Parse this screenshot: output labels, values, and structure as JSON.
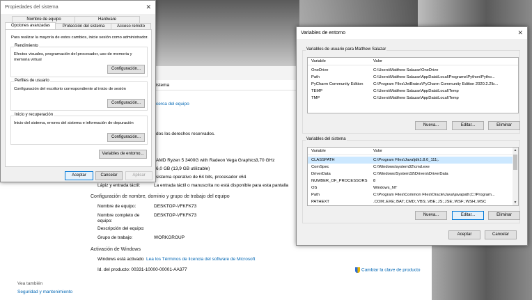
{
  "about": {
    "system_label_partial": "istema",
    "title_partial": "cerca del equipo",
    "rights_partial": "dos los derechos reservados.",
    "processor_value": "AMD Ryzen 5 3400G with Radeon Vega Graphics",
    "processor_speed": "3,70 GHz",
    "ram_value": "6,0 GB (13,9 GB utilizable)",
    "system_type_value": "sistema operativo de 64 bits, procesador x64",
    "pen_label": "Lápiz y entrada táctil:",
    "pen_value": "La entrada táctil o manuscrita no está disponible para esta pantalla",
    "domain_header": "Configuración de nombre, dominio y grupo de trabajo del equipo",
    "computer_name_label": "Nombre de equipo:",
    "computer_name_value": "DESKTOP-VFKFK73",
    "full_name_label": "Nombre completo de equipo:",
    "full_name_value": "DESKTOP-VFKFK73",
    "description_label": "Descripción del equipo:",
    "workgroup_label": "Grupo de trabajo:",
    "workgroup_value": "WORKGROUP",
    "activation_header": "Activación de Windows",
    "activation_status": "Windows está activado",
    "license_link": "Lea los Términos de licencia del software de Microsoft",
    "product_id": "Id. del producto: 00331-10000-00001-AA377",
    "change_key_link": "Cambiar la clave de producto",
    "see_also": "Vea también",
    "security_link": "Seguridad y mantenimiento"
  },
  "sysprop": {
    "title": "Propiedades del sistema",
    "tabs_top": [
      "Nombre de equipo",
      "Hardware"
    ],
    "tabs_bottom": [
      "Opciones avanzadas",
      "Protección del sistema",
      "Acceso remoto"
    ],
    "admin_note": "Para realizar la mayoría de estos cambios, inicie sesión como administrador.",
    "perf_label": "Rendimiento",
    "perf_text": "Efectos visuales, programación del procesador, uso de memoria y memoria virtual",
    "profiles_label": "Perfiles de usuario",
    "profiles_text": "Configuración del escritorio correspondiente al inicio de sesión",
    "startup_label": "Inicio y recuperación",
    "startup_text": "Inicio del sistema, errores del sistema e información de depuración",
    "config_button": "Configuración...",
    "env_button": "Variables de entorno...",
    "accept": "Aceptar",
    "cancel": "Cancelar",
    "apply": "Aplicar"
  },
  "env": {
    "title": "Variables de entorno",
    "user_section": "Variables de usuario para Matthew Salazar",
    "system_section": "Variables del sistema",
    "col_var": "Variable",
    "col_val": "Valor",
    "user_vars": [
      {
        "name": "OneDrive",
        "value": "C:\\Users\\Matthew Salazar\\OneDrive"
      },
      {
        "name": "Path",
        "value": "C:\\Users\\Matthew Salazar\\AppData\\Local\\Programs\\Python\\Pytho..."
      },
      {
        "name": "PyCharm Community Edition",
        "value": "C:\\Program Files\\JetBrains\\PyCharm Community Edition 2020.2.2\\b..."
      },
      {
        "name": "TEMP",
        "value": "C:\\Users\\Matthew Salazar\\AppData\\Local\\Temp"
      },
      {
        "name": "TMP",
        "value": "C:\\Users\\Matthew Salazar\\AppData\\Local\\Temp"
      }
    ],
    "system_vars": [
      {
        "name": "CLASSPATH",
        "value": "C:\\Program Files\\Java\\jdk1.8.0_111;."
      },
      {
        "name": "ComSpec",
        "value": "C:\\Windows\\system32\\cmd.exe"
      },
      {
        "name": "DriverData",
        "value": "C:\\Windows\\System32\\Drivers\\DriverData"
      },
      {
        "name": "NUMBER_OF_PROCESSORS",
        "value": "8"
      },
      {
        "name": "OS",
        "value": "Windows_NT"
      },
      {
        "name": "Path",
        "value": "C:\\Program Files\\Common Files\\Oracle\\Java\\javapath;C:\\Program..."
      },
      {
        "name": "PATHEXT",
        "value": ".COM;.EXE;.BAT;.CMD;.VBS;.VBE;.JS;.JSE;.WSF;.WSH;.MSC"
      }
    ],
    "new_button": "Nueva...",
    "edit_button": "Editar...",
    "delete_button": "Eliminar",
    "accept": "Aceptar",
    "cancel": "Cancelar"
  }
}
